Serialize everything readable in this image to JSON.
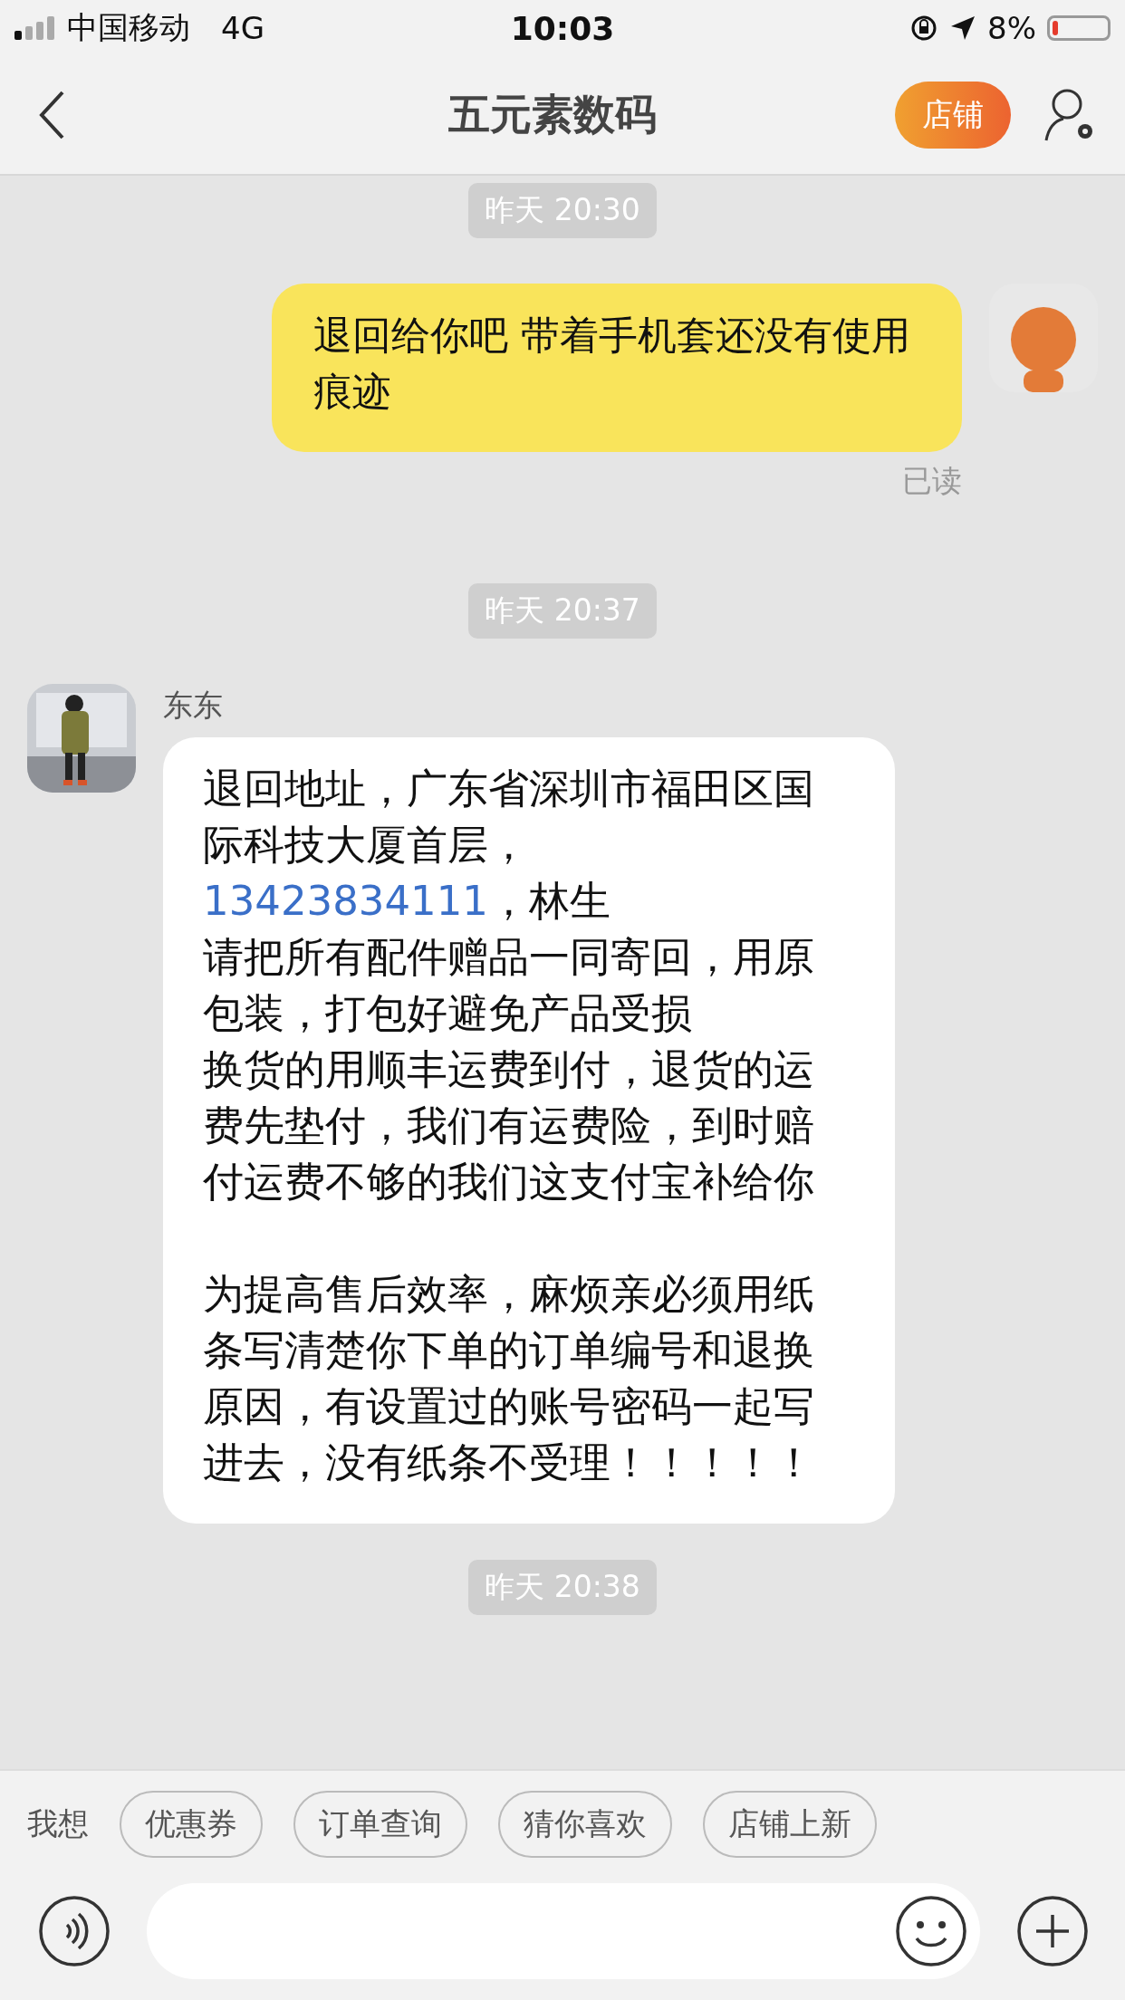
{
  "status_bar": {
    "carrier": "中国移动",
    "network": "4G",
    "time": "10:03",
    "battery_text": "8%"
  },
  "header": {
    "title": "五元素数码",
    "shop_button": "店铺"
  },
  "messages": [
    {
      "kind": "time",
      "text": "昨天 20:30"
    },
    {
      "kind": "outgoing",
      "text": "退回给你吧 带着手机套还没有使用痕迹",
      "read_label": "已读"
    },
    {
      "kind": "time",
      "text": "昨天 20:37"
    },
    {
      "kind": "incoming",
      "sender": "东东",
      "blocks": [
        [
          {
            "before": "退回地址，广东省深圳市福田区国际科技大厦首层，",
            "phone": "13423834111",
            "after": "，林生"
          },
          {
            "before": "请把所有配件赠品一同寄回，用原包装，打包好避免产品受损"
          },
          {
            "before": "换货的用顺丰运费到付，退货的运费先垫付，我们有运费险，到时赔付运费不够的我们这支付宝补给你"
          }
        ],
        [
          {
            "before": "为提高售后效率，麻烦亲必须用纸条写清楚你下单的订单编号和退换原因，有设置过的账号密码一起写进去，没有纸条不受理！！！！！"
          }
        ]
      ]
    },
    {
      "kind": "time",
      "text": "昨天 20:38"
    }
  ],
  "quick_bar": {
    "label": "我想",
    "chips": [
      "优惠券",
      "订单查询",
      "猜你喜欢",
      "店铺上新"
    ]
  }
}
